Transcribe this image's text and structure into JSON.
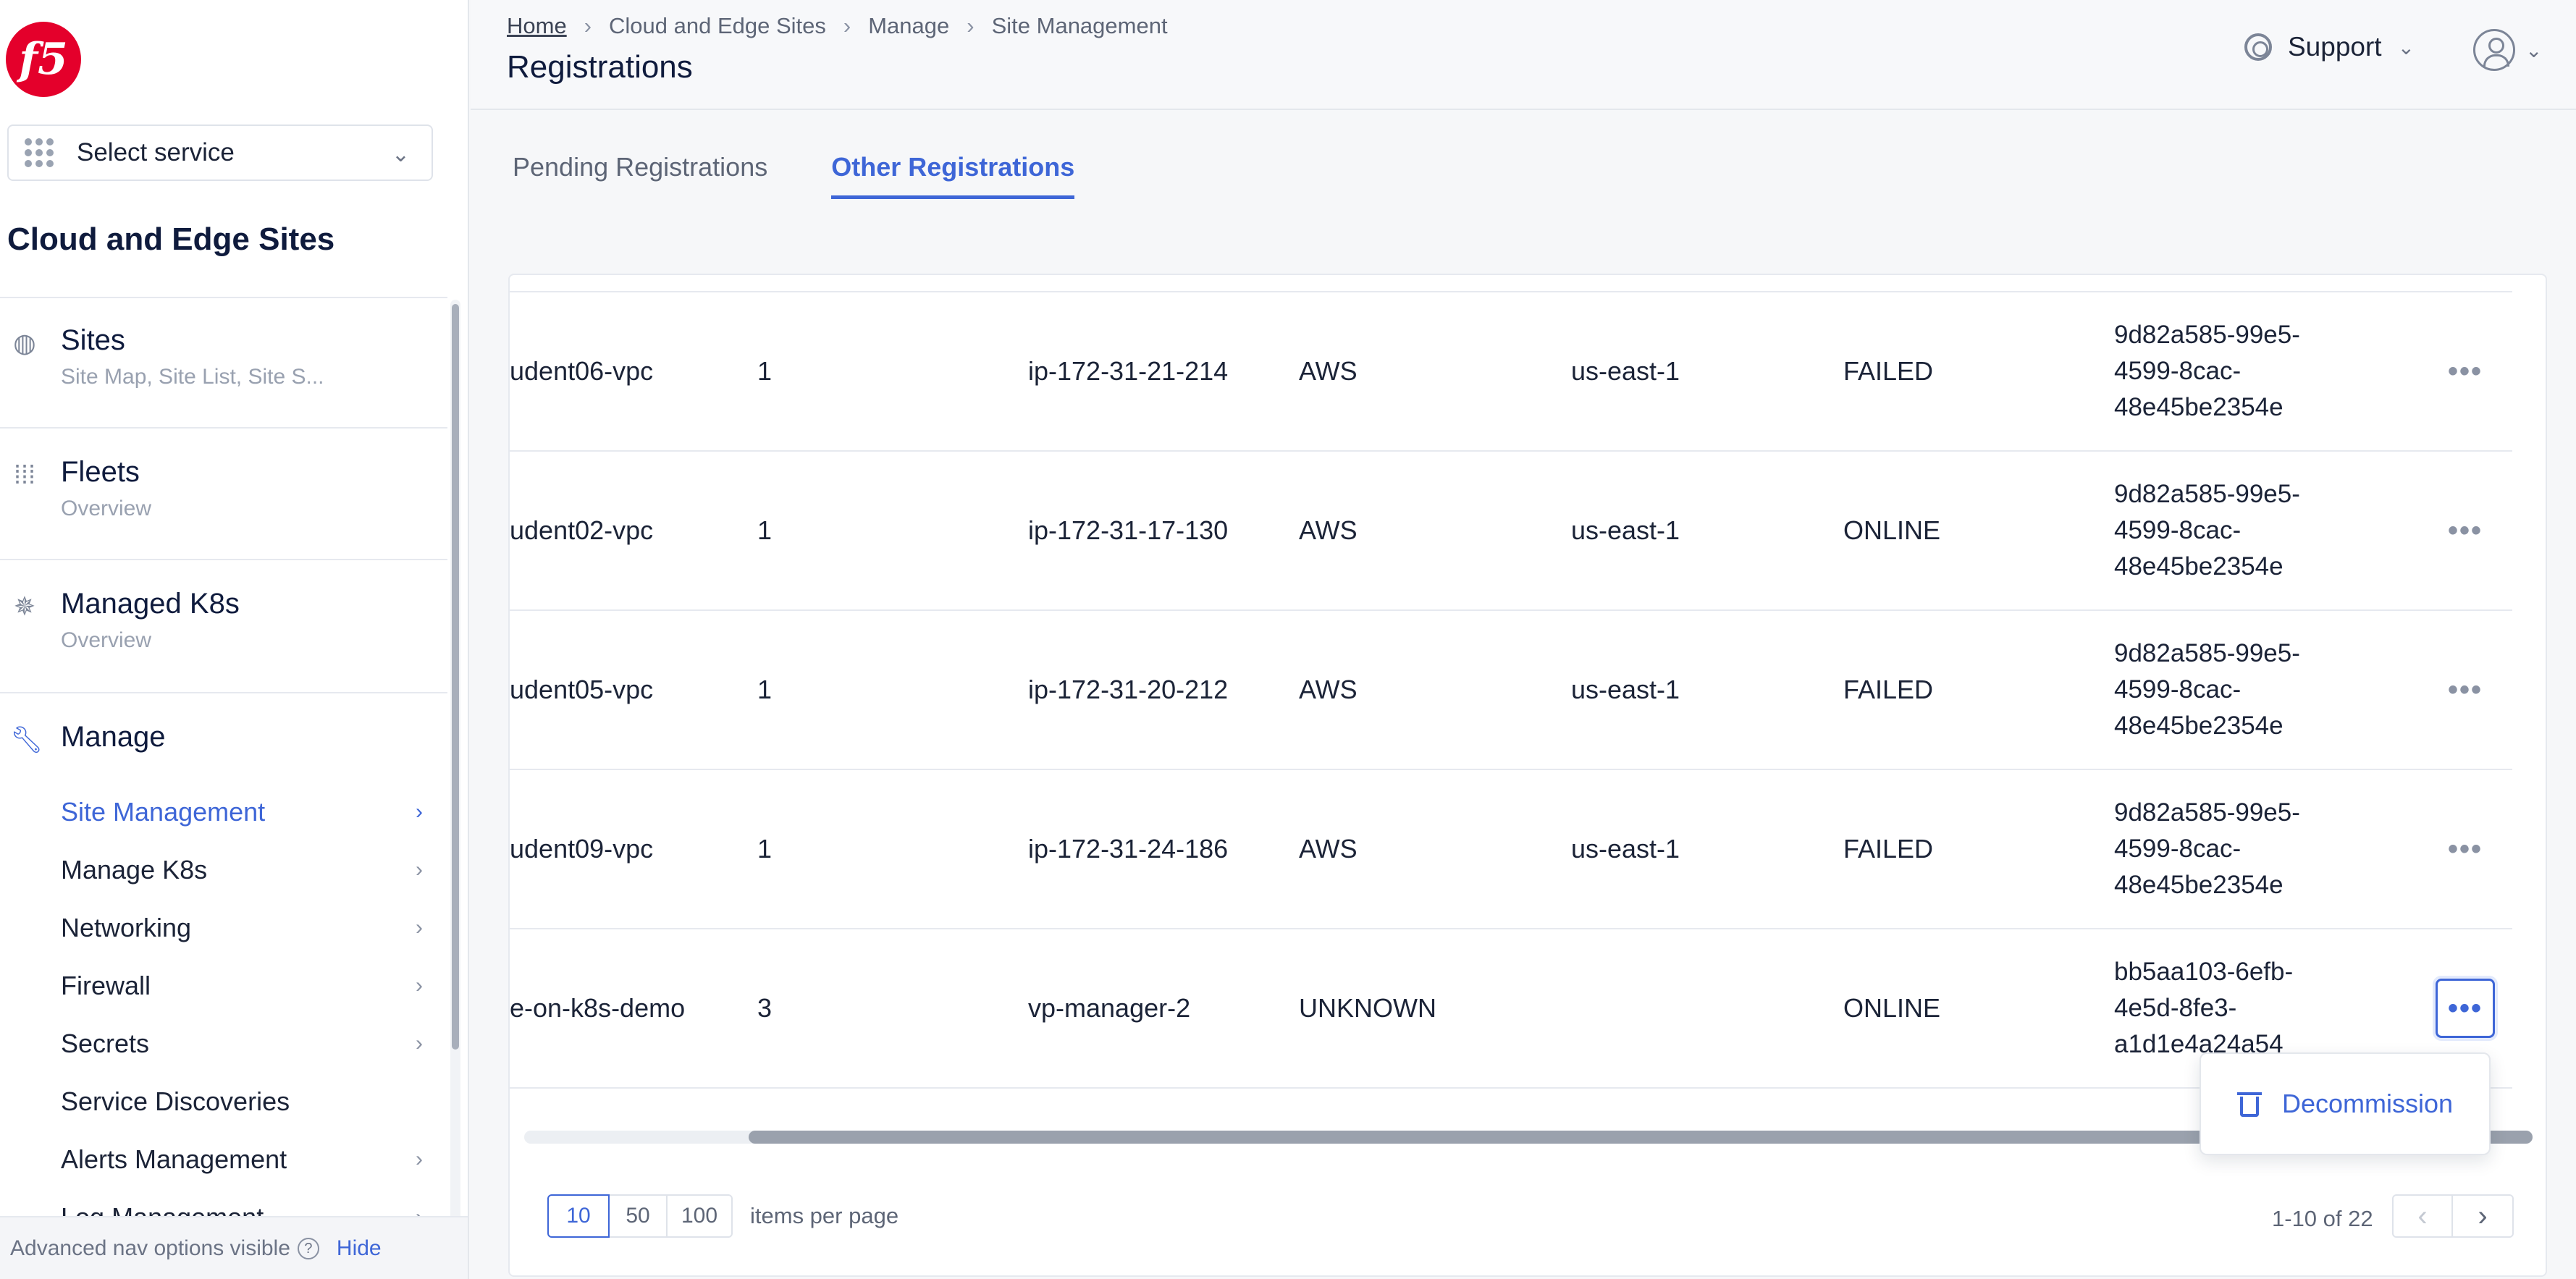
{
  "sidebar": {
    "logo_text": "f5",
    "service_select": "Select service",
    "section_title": "Cloud and Edge Sites",
    "groups": [
      {
        "title": "Sites",
        "subtitle": "Site Map, Site List, Site S..."
      },
      {
        "title": "Fleets",
        "subtitle": "Overview"
      },
      {
        "title": "Managed K8s",
        "subtitle": "Overview"
      },
      {
        "title": "Manage"
      }
    ],
    "manage_items": [
      {
        "label": "Site Management"
      },
      {
        "label": "Manage K8s"
      },
      {
        "label": "Networking"
      },
      {
        "label": "Firewall"
      },
      {
        "label": "Secrets"
      },
      {
        "label": "Service Discoveries"
      },
      {
        "label": "Alerts Management"
      },
      {
        "label": "Log Management"
      }
    ],
    "footer_text": "Advanced nav options visible",
    "footer_hide": "Hide"
  },
  "header": {
    "breadcrumb": [
      "Home",
      "Cloud and Edge Sites",
      "Manage",
      "Site Management"
    ],
    "title": "Registrations",
    "support": "Support"
  },
  "tabs": [
    {
      "label": "Pending Registrations"
    },
    {
      "label": "Other Registrations"
    }
  ],
  "table": {
    "rows": [
      {
        "name": "udent06-vpc",
        "nodes": "1",
        "hostname": "ip-172-31-21-214",
        "provider": "AWS",
        "region": "us-east-1",
        "state": "FAILED",
        "token": "9d82a585-99e5-4599-8cac-48e45be2354e"
      },
      {
        "name": "udent02-vpc",
        "nodes": "1",
        "hostname": "ip-172-31-17-130",
        "provider": "AWS",
        "region": "us-east-1",
        "state": "ONLINE",
        "token": "9d82a585-99e5-4599-8cac-48e45be2354e"
      },
      {
        "name": "udent05-vpc",
        "nodes": "1",
        "hostname": "ip-172-31-20-212",
        "provider": "AWS",
        "region": "us-east-1",
        "state": "FAILED",
        "token": "9d82a585-99e5-4599-8cac-48e45be2354e"
      },
      {
        "name": "udent09-vpc",
        "nodes": "1",
        "hostname": "ip-172-31-24-186",
        "provider": "AWS",
        "region": "us-east-1",
        "state": "FAILED",
        "token": "9d82a585-99e5-4599-8cac-48e45be2354e"
      },
      {
        "name": "e-on-k8s-demo",
        "nodes": "3",
        "hostname": "vp-manager-2",
        "provider": "UNKNOWN",
        "region": "",
        "state": "ONLINE",
        "token": "bb5aa103-6efb-4e5d-8fe3-a1d1e4a24a54"
      }
    ],
    "actions_glyph": "•••",
    "row_menu": {
      "decommission": "Decommission"
    }
  },
  "pagination": {
    "sizes": [
      "10",
      "50",
      "100"
    ],
    "items_per_page": "items per page",
    "range": "1-10 of 22"
  },
  "colors": {
    "accent": "#3e66d7",
    "brand": "#e4002b"
  }
}
